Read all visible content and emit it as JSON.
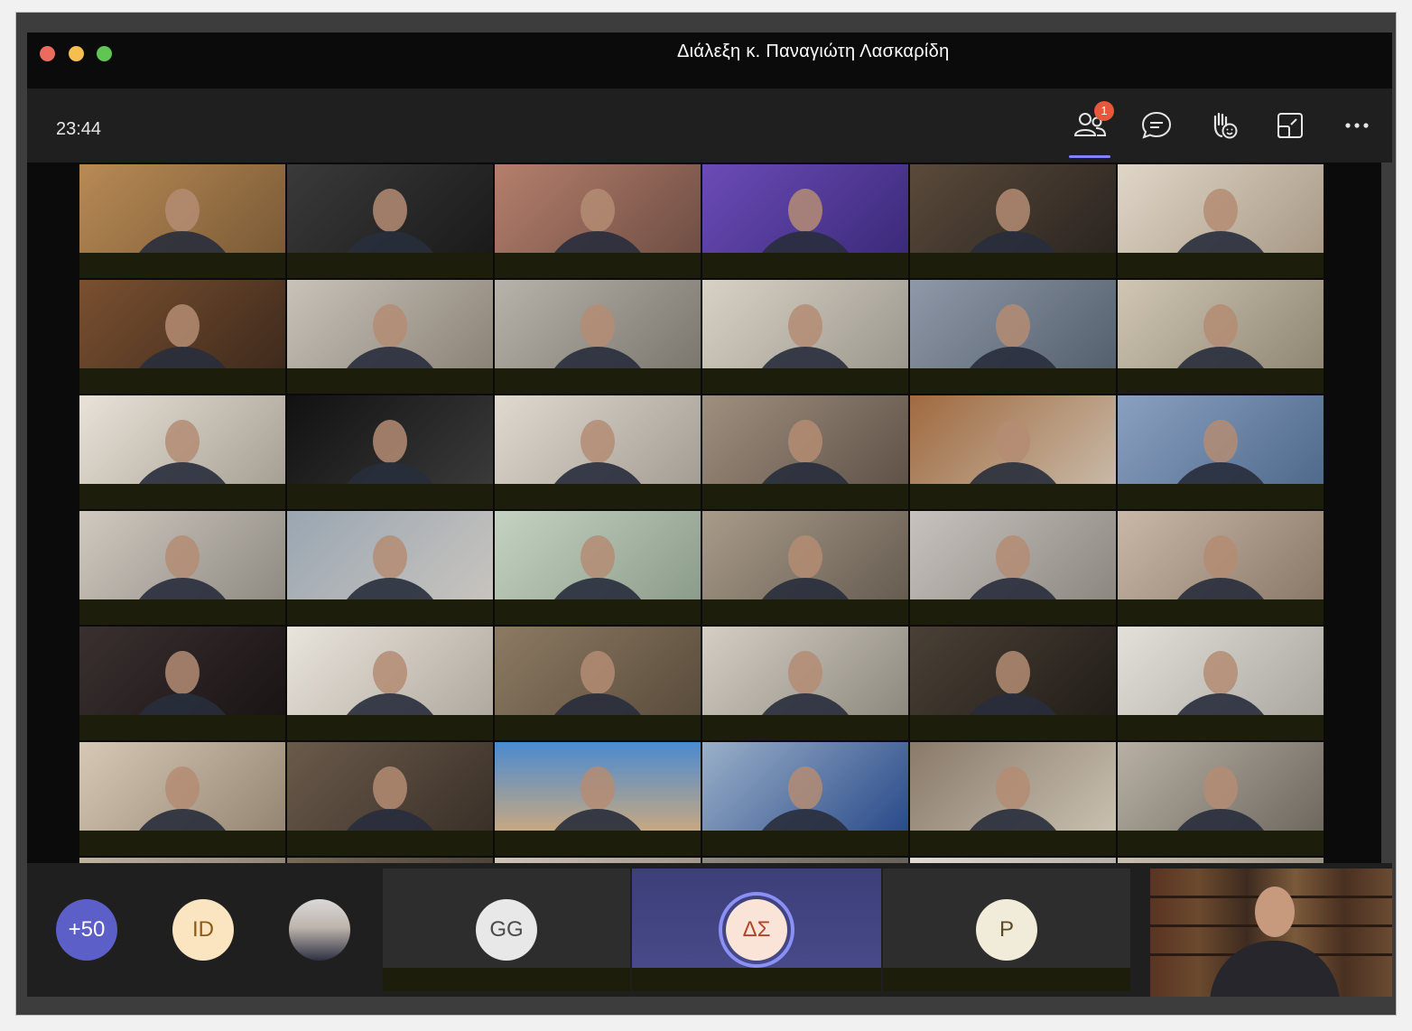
{
  "window": {
    "title": "Διάλεξη κ. Παναγιώτη Λασκαρίδη"
  },
  "toolbar": {
    "time": "23:44",
    "participants_badge": "1",
    "buttons": [
      {
        "icon": "people-icon"
      },
      {
        "icon": "chat-icon"
      },
      {
        "icon": "raise-hand-icon"
      },
      {
        "icon": "view-switch-icon"
      },
      {
        "icon": "more-icon"
      }
    ]
  },
  "overflow_strip": {
    "more_count": "+50",
    "avatars": [
      {
        "initials": "ID"
      },
      {
        "initials": "GG"
      },
      {
        "initials": "ΔΣ"
      },
      {
        "initials": "P"
      }
    ]
  },
  "colors": {
    "accent": "#7f85f5",
    "badge": "#e7573b",
    "avatar_more": "#5b5fc7",
    "avatar_id": "#fbe4c0",
    "avatar_gg": "#e8e8e8",
    "avatar_ds": "#f9e4d7",
    "avatar_p": "#f1ecd9"
  }
}
